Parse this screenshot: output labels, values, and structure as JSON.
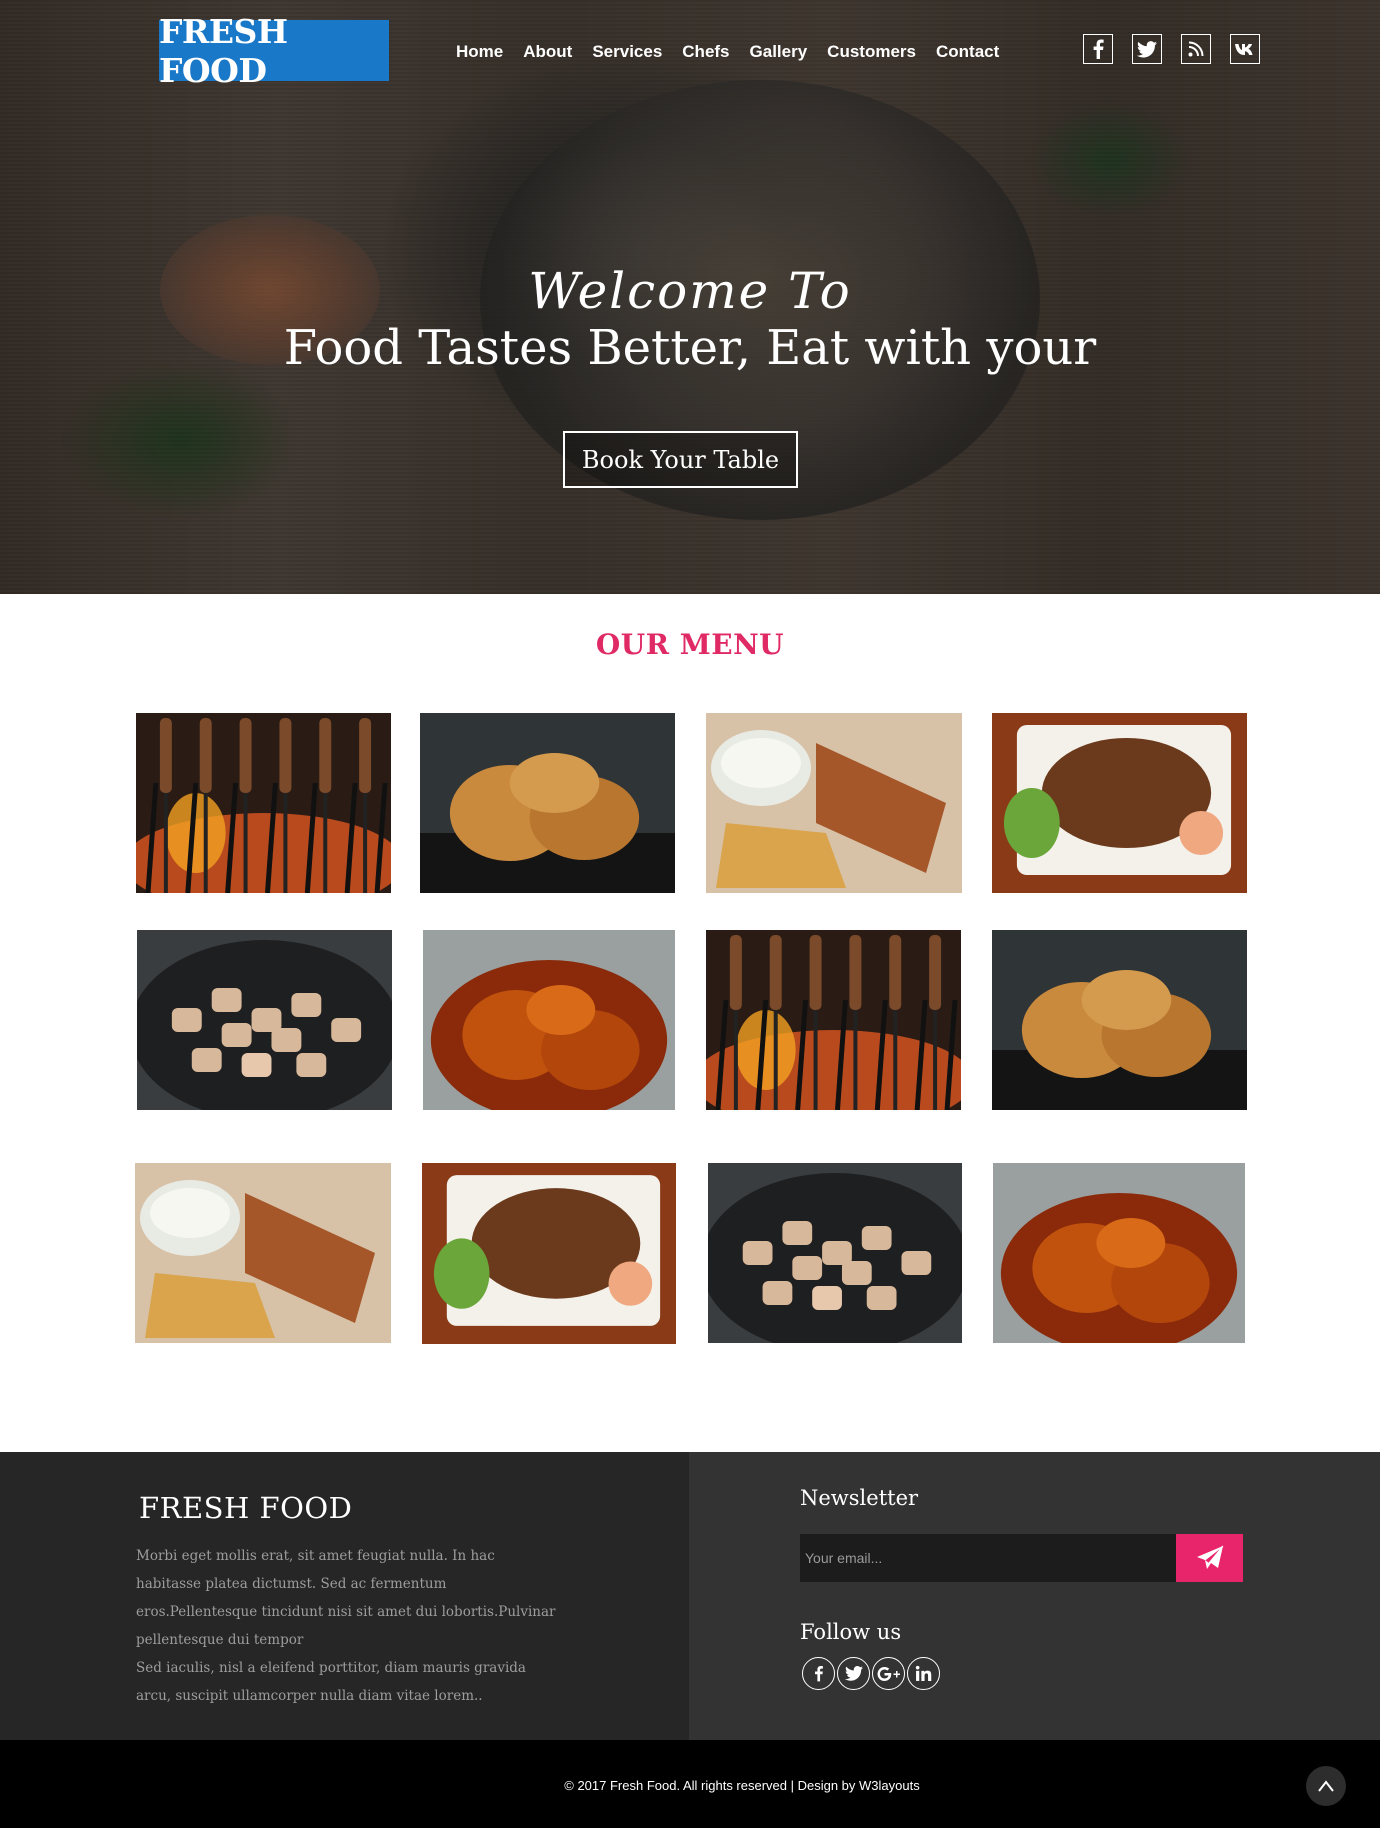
{
  "brand": {
    "logo_text": "FRESH FOOD",
    "logo_color": "#1a78c8"
  },
  "nav": {
    "items": [
      {
        "label": "Home"
      },
      {
        "label": "About"
      },
      {
        "label": "Services"
      },
      {
        "label": "Chefs"
      },
      {
        "label": "Gallery"
      },
      {
        "label": "Customers"
      },
      {
        "label": "Contact"
      }
    ]
  },
  "social_top": [
    {
      "icon": "facebook-icon"
    },
    {
      "icon": "twitter-icon"
    },
    {
      "icon": "rss-icon"
    },
    {
      "icon": "vk-icon"
    }
  ],
  "hero": {
    "welcome": "Welcome To",
    "tagline": "Food Tastes Better, Eat with your",
    "button_label": "Book Your Table"
  },
  "menu": {
    "title": "OUR MENU",
    "accent_color": "#e02a66",
    "dishes": [
      {
        "name": "grilled-skewers"
      },
      {
        "name": "fried-chicken"
      },
      {
        "name": "chicken-strips-dip"
      },
      {
        "name": "chicken-wings-platter"
      },
      {
        "name": "chicken-pieces-pan"
      },
      {
        "name": "glazed-wings"
      },
      {
        "name": "grilled-skewers"
      },
      {
        "name": "fried-chicken"
      },
      {
        "name": "chicken-strips-dip"
      },
      {
        "name": "chicken-wings-platter"
      },
      {
        "name": "chicken-pieces-pan"
      },
      {
        "name": "glazed-wings"
      }
    ]
  },
  "footer": {
    "brand": "FRESH FOOD",
    "para1": "Morbi eget mollis erat, sit amet feugiat nulla. In hac habitasse platea dictumst. Sed ac fermentum eros.Pellentesque tincidunt nisi sit amet dui lobortis.Pulvinar pellentesque dui tempor",
    "para2": "Sed iaculis, nisl a eleifend porttitor, diam mauris gravida arcu,  suscipit ullamcorper nulla diam vitae lorem..",
    "newsletter_title": "Newsletter",
    "email_placeholder": "Your email...",
    "follow_title": "Follow us",
    "follow_icons": [
      "facebook-icon",
      "twitter-icon",
      "google-plus-icon",
      "linkedin-icon"
    ],
    "send_color": "#e8246a",
    "copyright": "© 2017 Fresh Food. All rights reserved | Design by W3layouts"
  }
}
